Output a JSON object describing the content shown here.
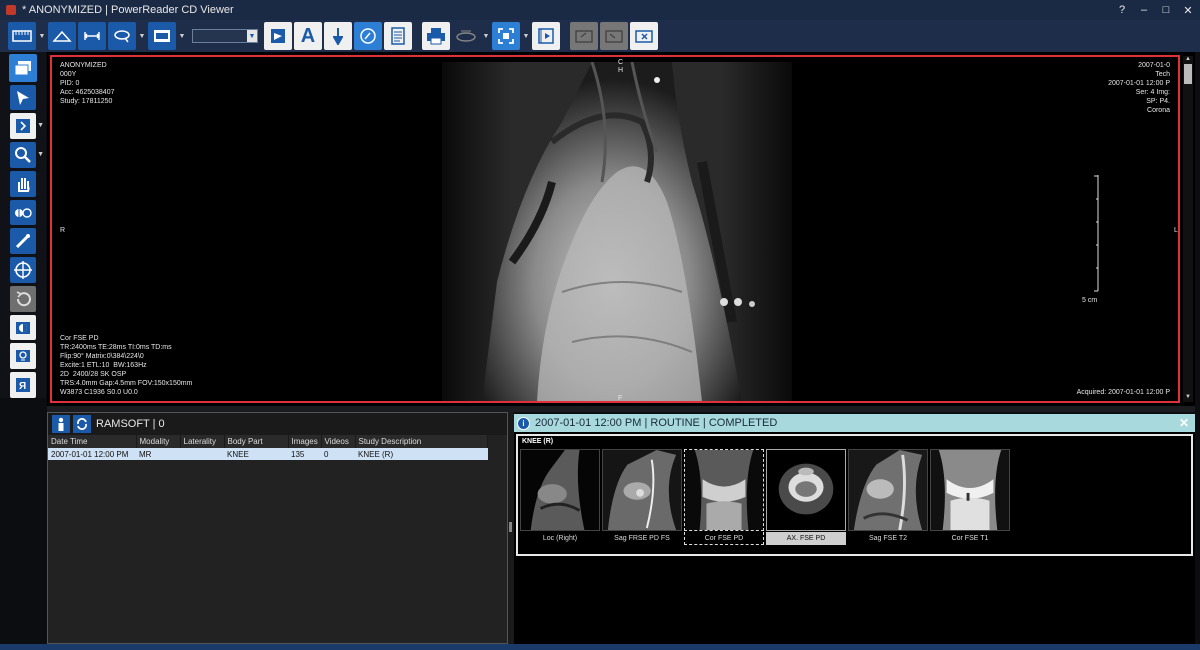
{
  "window": {
    "title": "* ANONYMIZED | PowerReader CD Viewer",
    "buttons": [
      "?",
      "–",
      "□",
      "✕"
    ]
  },
  "toolbar": {
    "icons": [
      "layout-icon",
      "measure-angle-icon",
      "measure-distance-icon",
      "roi-icon",
      "window-level-icon",
      "key-image-icon",
      "text-annotation-icon",
      "arrow-annotation-icon",
      "compass-icon",
      "report-icon",
      "print-icon",
      "burn-icon",
      "fullscreen-icon",
      "cine-icon",
      "export-icon",
      "import-icon",
      "close-study-icon"
    ],
    "combo_value": ""
  },
  "left_tools": [
    "series-layout-icon",
    "pointer-icon",
    "stack-icon",
    "zoom-icon",
    "pan-icon",
    "window-level-icon",
    "probe-icon",
    "crosshair-icon",
    "reset-icon",
    "invert-icon",
    "cine-icon",
    "flip-icon"
  ],
  "viewer": {
    "overlay_tl": "ANONYMIZED\n000Y\nPID: 0\nAcc: 4625038407\nStudy: 17811250",
    "overlay_tr": "2007-01-0\nTech\n2007-01-01 12:00 P\nSer: 4 Img:\nSP: P4.\nCorona",
    "overlay_bl": "Cor FSE PD\nTR:2400ms TE:28ms TI:0ms TD:ms\nFlip:90° Matrix:0\\384\\224\\0\nExcite:1 ETL:10  BW:163Hz\n2D  2400/28 SK OSP\nTRS:4.0mm Gap:4.5mm FOV:150x150mm\nW3873 C1936 S0.0 U0.0",
    "overlay_br": "Acquired: 2007-01-01 12:00 P",
    "orient_top": "C\nH",
    "orient_left": "R",
    "orient_right": "L",
    "orient_bottom": "F",
    "ruler_label": "5 cm"
  },
  "study_panel": {
    "title": "RAMSOFT | 0",
    "columns": [
      "Date Time",
      "Modality",
      "Laterality",
      "Body Part",
      "Images",
      "Videos",
      "Study Description"
    ],
    "rows": [
      [
        "2007-01-01 12:00 PM",
        "MR",
        "",
        "KNEE",
        "135",
        "0",
        "KNEE (R)"
      ]
    ]
  },
  "series_panel": {
    "header": "2007-01-01 12:00 PM | ROUTINE | COMPLETED",
    "study_label": "KNEE (R)",
    "series": [
      {
        "label": "Loc (Right)"
      },
      {
        "label": "Sag FRSE PD FS"
      },
      {
        "label": "Cor FSE PD"
      },
      {
        "label": "AX. FSE PD"
      },
      {
        "label": "Sag FSE T2"
      },
      {
        "label": "Cor FSE T1"
      }
    ]
  },
  "colors": {
    "accent": "#1a5aa8",
    "viewport_border": "#e0303a",
    "header_bar": "#a7d9dd",
    "selected_row": "#cfe1f4"
  }
}
